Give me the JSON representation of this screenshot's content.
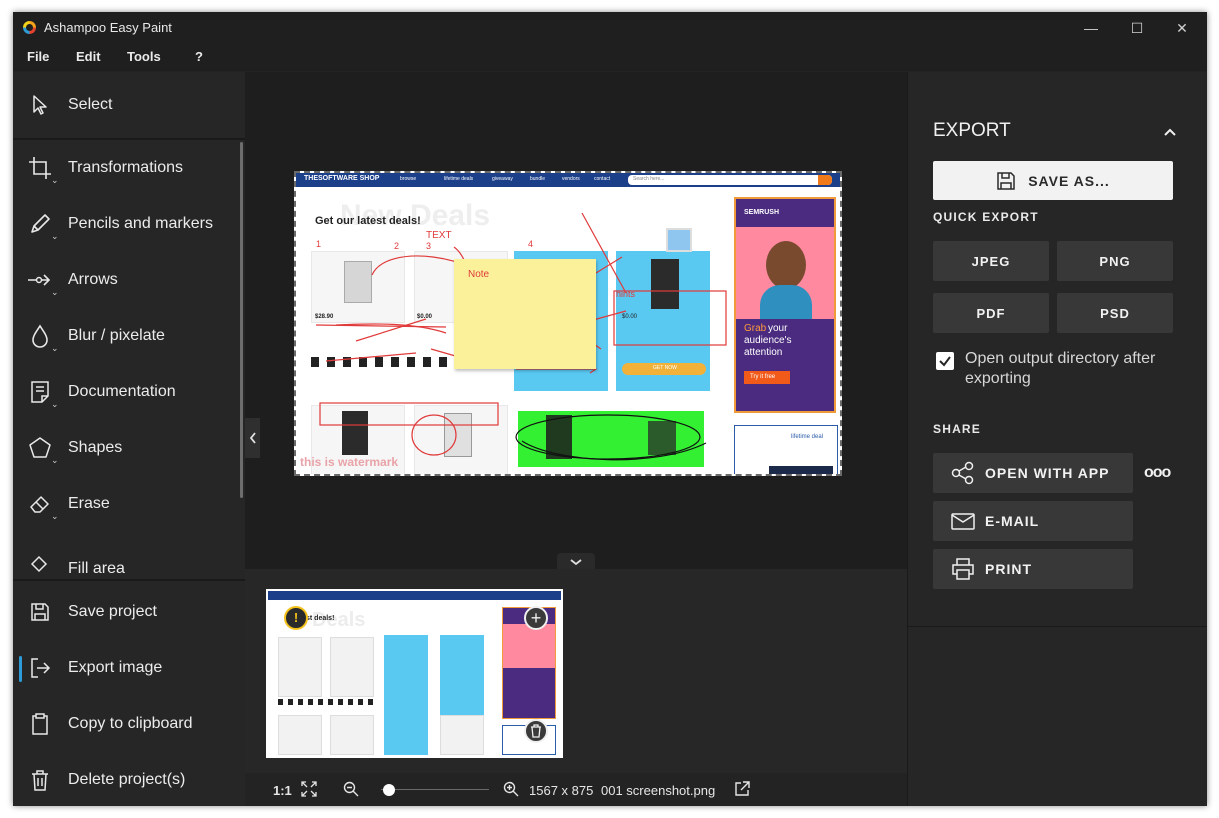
{
  "window": {
    "title": "Ashampoo Easy Paint",
    "controls": {
      "minimize": "—",
      "maximize": "☐",
      "close": "✕"
    }
  },
  "menu": [
    {
      "label": "File"
    },
    {
      "label": "Edit"
    },
    {
      "label": "Tools"
    },
    {
      "label": "?"
    }
  ],
  "tools": [
    {
      "label": "Select",
      "icon": "cursor-icon"
    },
    {
      "label": "Transformations",
      "icon": "crop-icon"
    },
    {
      "label": "Pencils and markers",
      "icon": "pencil-icon"
    },
    {
      "label": "Arrows",
      "icon": "arrow-icon"
    },
    {
      "label": "Blur / pixelate",
      "icon": "blur-drop-icon"
    },
    {
      "label": "Documentation",
      "icon": "document-icon"
    },
    {
      "label": "Shapes",
      "icon": "pentagon-icon"
    },
    {
      "label": "Erase",
      "icon": "eraser-icon"
    },
    {
      "label": "Fill area",
      "icon": "fill-bucket-icon"
    }
  ],
  "actions": [
    {
      "label": "Save project",
      "icon": "floppy-icon"
    },
    {
      "label": "Export image",
      "icon": "export-icon"
    },
    {
      "label": "Copy to clipboard",
      "icon": "clipboard-icon"
    },
    {
      "label": "Delete project(s)",
      "icon": "trash-icon"
    }
  ],
  "status": {
    "ratio": "1:1",
    "dimensions": "1567 x 875",
    "filename": "001 screenshot.png",
    "zoom_fraction": 0.0
  },
  "export": {
    "title": "EXPORT",
    "save_as": "SAVE AS...",
    "quick_export_label": "QUICK EXPORT",
    "formats": [
      "JPEG",
      "PNG",
      "PDF",
      "PSD"
    ],
    "open_dir_label": "Open output directory after exporting",
    "open_dir_checked": true,
    "share_label": "SHARE",
    "share": [
      {
        "label": "OPEN WITH APP"
      },
      {
        "label": "E-MAIL"
      },
      {
        "label": "PRINT"
      }
    ],
    "more": "ooo"
  },
  "document": {
    "site_logo": "THESOFTWARE SHOP",
    "nav": [
      "browse",
      "lifetime deals",
      "giveaway",
      "bundle",
      "vendors",
      "contact"
    ],
    "search_placeholder": "Search here...",
    "heading": "Get our latest deals!",
    "heading_bg": "New Deals",
    "annotation_numbers": [
      "1",
      "2",
      "3",
      "4"
    ],
    "annotation_text": "TEXT",
    "note": "Note",
    "hints": "hints",
    "watermark": "this is watermark",
    "ad": {
      "brand": "SEMRUSH",
      "headline_accent": "Grab",
      "headline": "your audience's attention",
      "cta": "Try it free"
    },
    "ad2_text": "lifetime deal",
    "prices": [
      "$28.90",
      "$0.00",
      "$0.00"
    ],
    "cta_label": "GET NOW"
  },
  "thumbnail": {
    "warning": "!",
    "add": "+",
    "heading": "st deals!",
    "bg": "Deals"
  },
  "colors": {
    "accent": "#2d9bd8",
    "annotation": "#e03a3a",
    "note": "#fbf19a",
    "highlight_green": "#33f033",
    "card_blue": "#59c9f2",
    "ad_purple": "#4a2b7f"
  }
}
